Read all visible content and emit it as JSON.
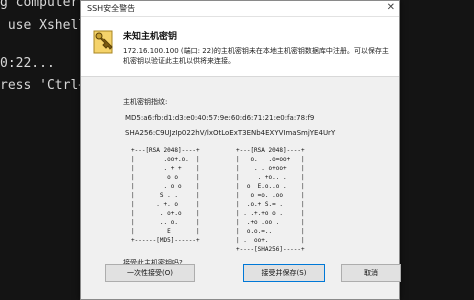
{
  "terminal": {
    "lines": [
      "g computer, inc. All rights reserved.",
      " use Xshell p",
      "",
      "0:22...",
      "",
      "ress 'Ctrl+Al"
    ]
  },
  "dialog": {
    "window_title": "SSH安全警告",
    "heading": "未知主机密钥",
    "message": "172.16.100.100 (端口: 22)的主机密钥未在本地主机密钥数据库中注册。可以保存主机密钥以验证此主机以供将来连接。",
    "fingerprint_label": "主机密钥指纹:",
    "md5": "MD5:a6:fb:d1:d3:e0:40:57:9e:60:d6:71:21:e0:fa:78:f9",
    "sha256": "SHA256:C9UJzIp022hV/lxOtLoExT3ENb4EXYVImaSmjYE4UrY",
    "randomart_md5": "+---[RSA 2048]----+\n|        .oo+.o.  |\n|        . + +    |\n|         o o     |\n|        . o o    |\n|       S . .     |\n|      . +. o     |\n|       . o+.o    |\n|       .. o.     |\n|         E       |\n+------[MD5]------+",
    "randomart_sha": "+---[RSA 2048]----+\n|   o.   .o=oo+   |\n|    . . o+oo+    |\n|     . +o.. .    |\n|  o  E.o..o .    |\n|   o =o. .oo     |\n|  .o.+ S.= .     |\n| . .+.+o o .     |\n|  .+o .oo .      |\n|  o.o.=..        |\n| .  oo+.         |\n+----[SHA256]-----+",
    "question": "接受此主机密钥吗?",
    "buttons": {
      "accept_once": "一次性接受(O)",
      "accept_save": "接受并保存(S)",
      "cancel": "取消"
    }
  }
}
